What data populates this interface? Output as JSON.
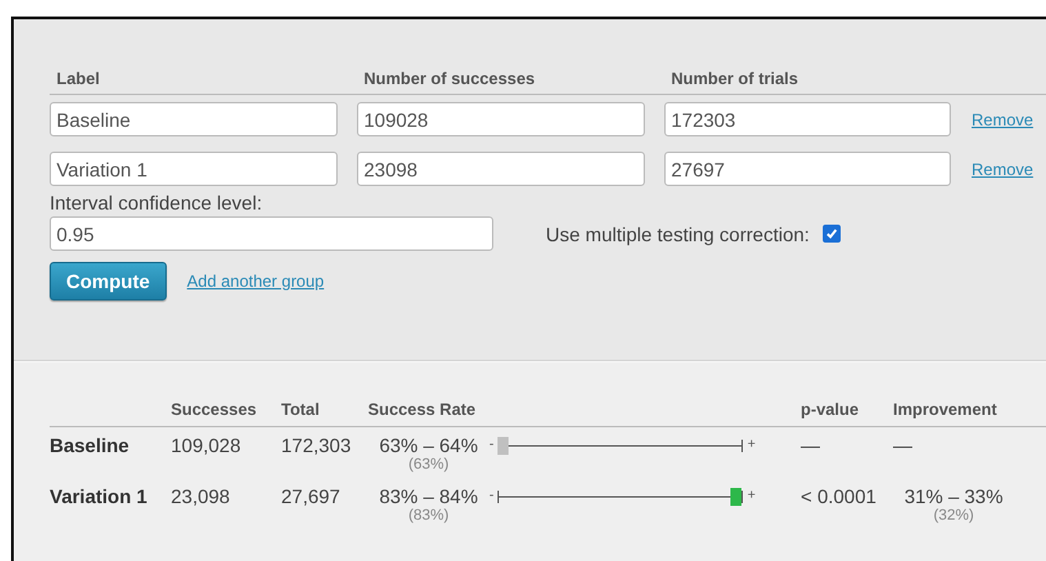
{
  "form": {
    "headers": [
      "Label",
      "Number of successes",
      "Number of trials"
    ],
    "groups": [
      {
        "label": "Baseline",
        "successes": "109028",
        "trials": "172303",
        "remove": "Remove"
      },
      {
        "label": "Variation 1",
        "successes": "23098",
        "trials": "27697",
        "remove": "Remove"
      }
    ],
    "confidence": {
      "label": "Interval confidence level:",
      "value": "0.95"
    },
    "correction": {
      "label": "Use multiple testing correction:",
      "checked": true
    },
    "compute": "Compute",
    "add_group": "Add another group"
  },
  "results": {
    "columns": [
      "Successes",
      "Total",
      "Success Rate",
      "p-value",
      "Improvement"
    ],
    "rows": [
      {
        "label": "Baseline",
        "successes": "109,028",
        "total": "172,303",
        "rate": "63% – 64%",
        "rate_point": "(63%)",
        "minus": "-",
        "plus": "+",
        "level": 0.02,
        "color": "#c0c0c0",
        "p_value": "—",
        "improvement": "—"
      },
      {
        "label": "Variation 1",
        "successes": "23,098",
        "total": "27,697",
        "rate": "83% – 84%",
        "rate_point": "(83%)",
        "minus": "-",
        "plus": "+",
        "level": 0.97,
        "color": "#2db84a",
        "p_value": "< 0.0001",
        "improvement": "31% – 33%",
        "improvement_point": "(32%)"
      }
    ]
  }
}
